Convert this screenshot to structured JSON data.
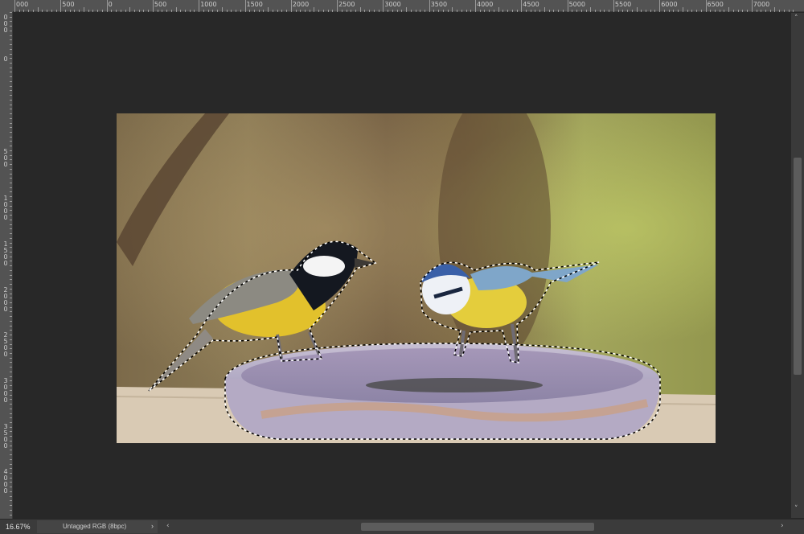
{
  "ruler": {
    "top_labels": [
      "000",
      "500",
      "0",
      "500",
      "1000",
      "1500",
      "2000",
      "2500",
      "3000",
      "3500",
      "4000",
      "4500",
      "5000",
      "5500",
      "6000",
      "6500",
      "7000"
    ],
    "left_labels": [
      "0\n0\n0",
      "0",
      "5\n0\n0",
      "1\n0\n0\n0",
      "1\n5\n0\n0",
      "2\n0\n0\n0",
      "2\n5\n0\n0",
      "3\n0\n0\n0",
      "3\n5\n0\n0",
      "4\n0\n0\n0"
    ]
  },
  "status": {
    "zoom": "16.67%",
    "doc_info": "Untagged RGB (8bpc)",
    "doc_info_arrow": "›"
  },
  "scroll": {
    "up_arrow": "˄",
    "down_arrow": "˅",
    "left_arrow": "‹",
    "right_arrow": "›"
  },
  "icons": {
    "selection": "marching-ants-selection",
    "dropdown": "chevron-right-icon"
  },
  "colors": {
    "workspace": "#282828",
    "ruler": "#535353",
    "status_bar": "#3b3b3b"
  }
}
